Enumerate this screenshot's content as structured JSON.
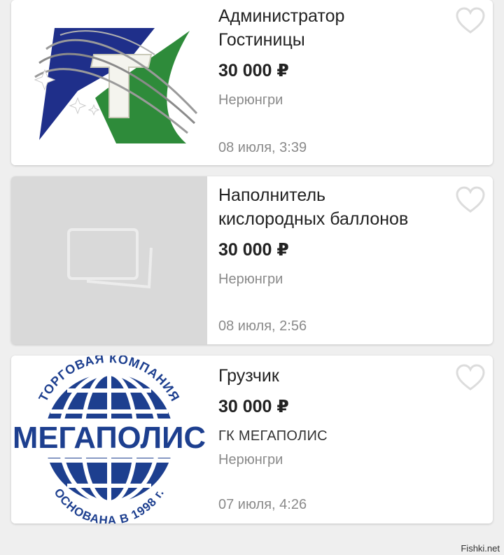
{
  "listings": [
    {
      "title_line1": "Администратор",
      "title_line2": "Гостиницы",
      "price": "30 000 ₽",
      "company": "",
      "city": "Нерюнгри",
      "date": "08 июля, 3:39",
      "image": "hotel-logo"
    },
    {
      "title_line1": "Наполнитель",
      "title_line2": "кислородных баллонов",
      "price": "30 000 ₽",
      "company": "",
      "city": "Нерюнгри",
      "date": "08 июля, 2:56",
      "image": "placeholder-photos-icon"
    },
    {
      "title_line1": "Грузчик",
      "title_line2": "",
      "price": "30 000 ₽",
      "company": "ГК МЕГАПОЛИС",
      "city": "Нерюнгри",
      "date": "07 июля, 4:26",
      "image": "megapolis-logo"
    }
  ],
  "megapolis_logo": {
    "top_arc": "ТОРГОВАЯ КОМПАНИЯ",
    "wordmark": "МЕГАПОЛИС",
    "bottom_arc": "ОСНОВАНА В 1998 г."
  },
  "watermark": "Fishki.net",
  "colors": {
    "background": "#efefef",
    "card": "#ffffff",
    "text": "#222222",
    "muted": "#8a8a8a",
    "heart_outline": "#dcdcdc",
    "logo_blue": "#1f2f8a",
    "logo_green": "#2e8b3a",
    "megapolis_blue": "#1d3f8f"
  }
}
